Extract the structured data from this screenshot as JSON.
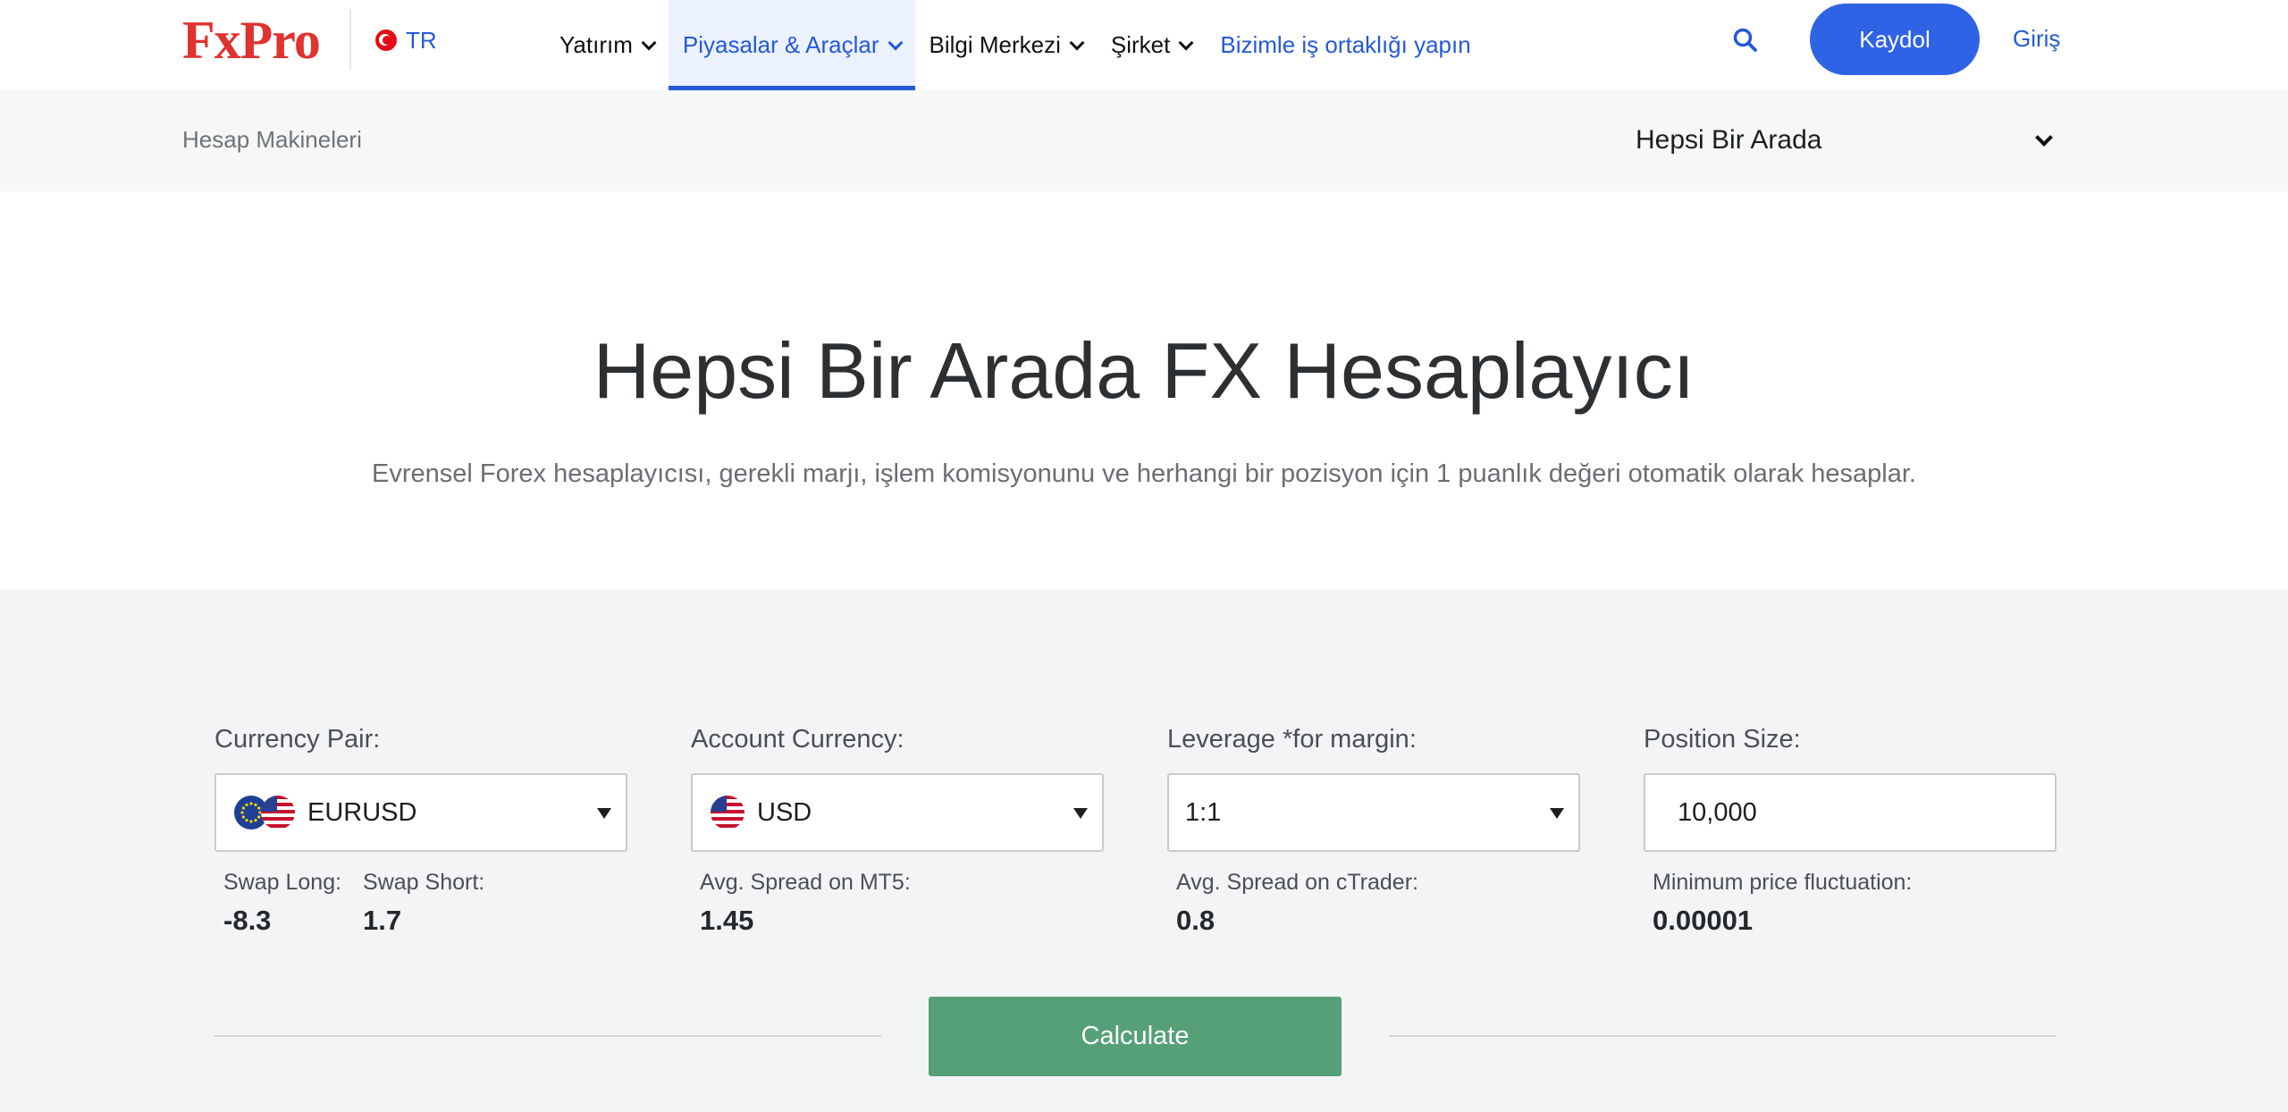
{
  "header": {
    "logo": "FxPro",
    "language": "TR",
    "nav": [
      {
        "label": "Yatırım"
      },
      {
        "label": "Piyasalar & Araçlar"
      },
      {
        "label": "Bilgi Merkezi"
      },
      {
        "label": "Şirket"
      }
    ],
    "partner_link": "Bizimle iş ortaklığı yapın",
    "register_label": "Kaydol",
    "login_label": "Giriş"
  },
  "subbar": {
    "title": "Hesap Makineleri",
    "selected": "Hepsi Bir Arada"
  },
  "hero": {
    "title": "Hepsi Bir Arada FX Hesaplayıcı",
    "subtitle": "Evrensel Forex hesaplayıcısı, gerekli marjı, işlem komisyonunu ve herhangi bir pozisyon için 1 puanlık değeri otomatik olarak hesaplar."
  },
  "calculator": {
    "currency_pair": {
      "label": "Currency Pair:",
      "value": "EURUSD"
    },
    "account_currency": {
      "label": "Account Currency:",
      "value": "USD"
    },
    "leverage": {
      "label": "Leverage *for margin:",
      "value": "1:1"
    },
    "position_size": {
      "label": "Position Size:",
      "value": "10,000"
    },
    "swap_long": {
      "label": "Swap Long:",
      "value": "-8.3"
    },
    "swap_short": {
      "label": "Swap Short:",
      "value": "1.7"
    },
    "spread_mt5": {
      "label": "Avg. Spread on MT5:",
      "value": "1.45"
    },
    "spread_ctrader": {
      "label": "Avg. Spread on cTrader:",
      "value": "0.8"
    },
    "min_fluctuation": {
      "label": "Minimum price fluctuation:",
      "value": "0.00001"
    },
    "calculate_label": "Calculate"
  },
  "colors": {
    "brand_red": "#e0322f",
    "accent_blue": "#2f63e6",
    "calculate_green": "#55a077"
  }
}
